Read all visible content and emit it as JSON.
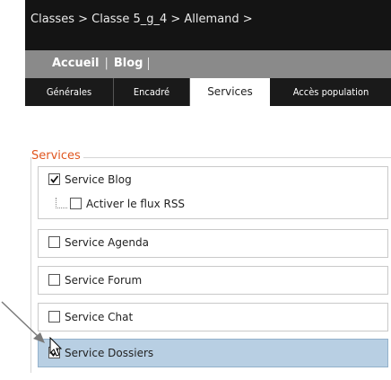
{
  "breadcrumb": "Classes > Classe 5_g_4 > Allemand >",
  "nav": {
    "home": "Accueil",
    "separator": "|",
    "blog": "Blog"
  },
  "tabs": [
    {
      "label": "Générales",
      "active": false
    },
    {
      "label": "Encadré",
      "active": false
    },
    {
      "label": "Services",
      "active": true
    },
    {
      "label": "Accès population",
      "active": false
    }
  ],
  "services": {
    "legend": "Services",
    "items": [
      {
        "label": "Service Blog",
        "checked": true
      },
      {
        "label": "Activer le flux RSS",
        "checked": false
      },
      {
        "label": "Service Agenda",
        "checked": false
      },
      {
        "label": "Service Forum",
        "checked": false
      },
      {
        "label": "Service Chat",
        "checked": false
      },
      {
        "label": "Service Dossiers",
        "checked": true,
        "highlighted": true
      }
    ]
  },
  "colors": {
    "legend": "#e0561f",
    "highlight": "#b8cfe3",
    "tabbar": "#1a1a1a",
    "navbar": "#8a8a8a",
    "topbar": "#141414"
  },
  "icons": [
    "checkmark-icon",
    "pointer-arrow-icon",
    "mouse-cursor-icon",
    "tree-connector-icon"
  ]
}
